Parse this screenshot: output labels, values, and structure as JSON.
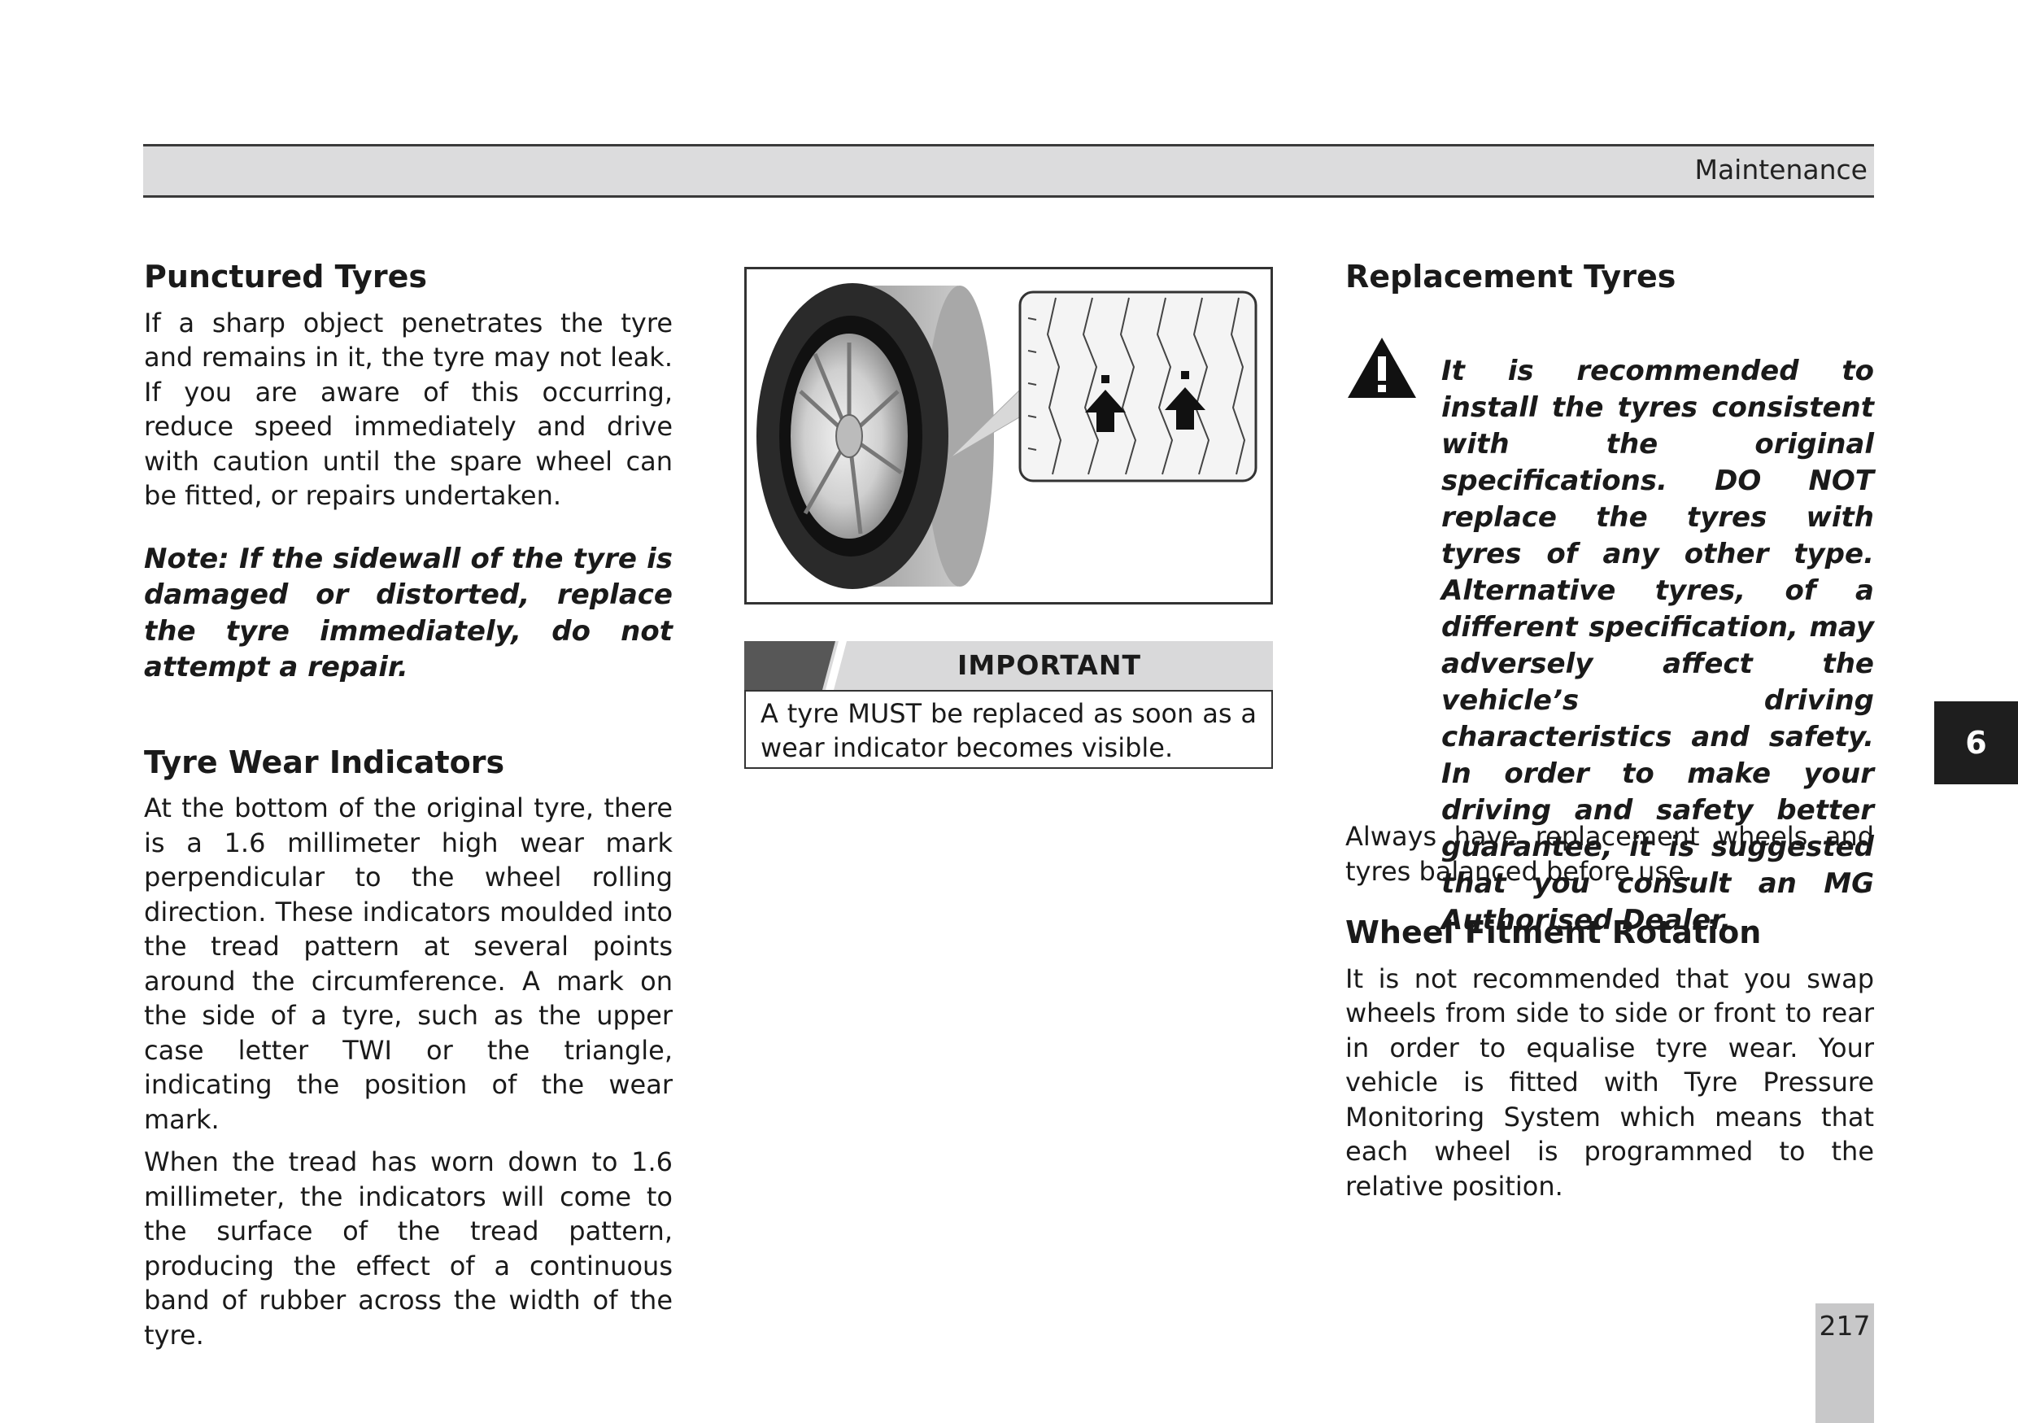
{
  "header": {
    "section": "Maintenance"
  },
  "left": {
    "punctured": {
      "title": "Punctured Tyres",
      "body": "If a sharp object penetrates the tyre and remains in it, the tyre may not leak. If you are aware of this occurring, reduce speed immediately and drive with caution until the spare wheel can be fitted, or repairs undertaken.",
      "note": "Note: If the sidewall of the tyre is damaged or distorted, replace the tyre immediately, do not attempt a repair."
    },
    "wear": {
      "title": "Tyre Wear Indicators",
      "p1": "At the bottom of the original tyre, there is a 1.6 millimeter high wear mark perpendicular to the wheel rolling direction. These indicators moulded into the tread pattern at several points around the circumference. A mark on the side of a tyre, such as the upper case letter TWI or the triangle, indicating the position of the wear mark.",
      "p2": "When the tread has worn down to 1.6 millimeter, the indicators will come to the surface of the tread pattern, producing the effect of a continuous band of rubber across the width of the tyre."
    }
  },
  "important": {
    "label": "IMPORTANT",
    "text": "A tyre MUST be replaced as soon as a wear indicator becomes visible."
  },
  "right": {
    "replacement": {
      "title": "Replacement Tyres",
      "warning": "It is recommended to install the tyres consistent with the original specifications. DO NOT replace the tyres with tyres of any other type. Alternative tyres, of a different specification, may adversely affect the vehicle’s driving characteristics and safety. In order to make your driving and safety better guarantee, it is suggested that you consult an MG Authorised Dealer.",
      "body": "Always have replacement wheels and tyres balanced before use."
    },
    "rotation": {
      "title": "Wheel Fitment Rotation",
      "body": "It is not recommended that you swap wheels from side to side or front to rear in order to equalise tyre wear. Your vehicle is fitted with Tyre Pressure Monitoring System which means that each wheel is programmed to the relative position."
    }
  },
  "chapter_tab": "6",
  "page_number": "217"
}
